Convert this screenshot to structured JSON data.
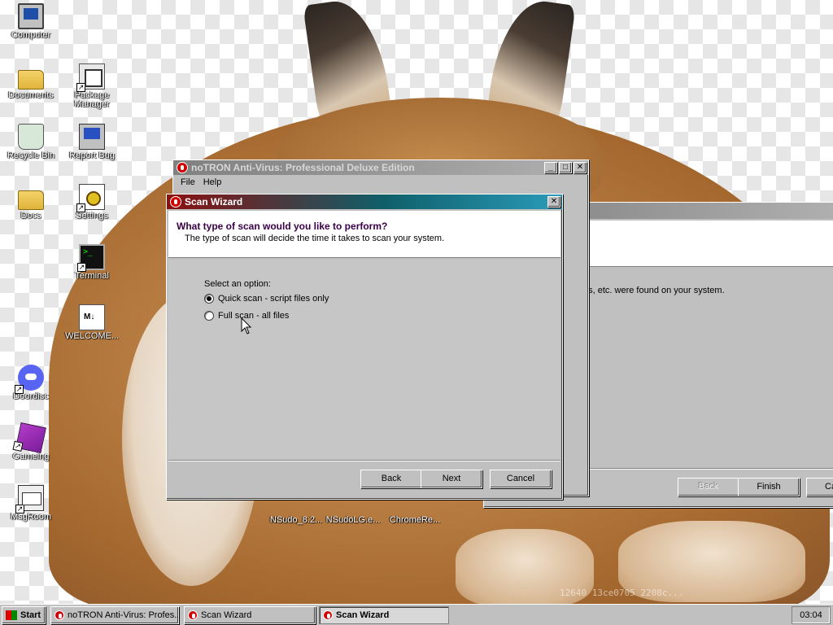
{
  "desktop": {
    "icons": [
      {
        "label": "Computer",
        "icon": "computer-icon"
      },
      {
        "label": "Documents",
        "icon": "folder-icon"
      },
      {
        "label": "Package Manager",
        "icon": "package-icon"
      },
      {
        "label": "Recycle Bin",
        "icon": "recycle-bin-icon"
      },
      {
        "label": "Report Bug",
        "icon": "report-bug-icon"
      },
      {
        "label": "Docs",
        "icon": "folder-icon"
      },
      {
        "label": "Settings",
        "icon": "settings-icon"
      },
      {
        "label": "Terminal",
        "icon": "terminal-icon"
      },
      {
        "label": "WELCOME...",
        "icon": "markdown-file-icon"
      },
      {
        "label": "Doordisc",
        "icon": "discord-icon"
      },
      {
        "label": "Gameing",
        "icon": "game-cube-icon"
      },
      {
        "label": "MsgRoom",
        "icon": "message-icon"
      },
      {
        "label": "NSudo_8.2...",
        "icon": "file-icon"
      },
      {
        "label": "NSudoLG.e...",
        "icon": "file-icon"
      },
      {
        "label": "ChromeRe...",
        "icon": "file-icon"
      }
    ],
    "wallpaper_text": "12640 13ce0705 2208c..."
  },
  "main_window": {
    "title": "noTRON Anti-Virus: Professional Deluxe Edition",
    "menu": [
      "File",
      "Help"
    ]
  },
  "back_window": {
    "body_text": "es, etc. were found on your system.",
    "buttons": {
      "back": "Back",
      "finish": "Finish",
      "cancel": "Ca"
    }
  },
  "wizard": {
    "title": "Scan Wizard",
    "heading": "What type of scan would you like to perform?",
    "subheading": "The type of scan will decide the time it takes to scan your system.",
    "prompt": "Select an option:",
    "options": [
      {
        "label": "Quick scan - script files only",
        "selected": true
      },
      {
        "label": "Full scan - all files",
        "selected": false
      }
    ],
    "buttons": {
      "back": "Back",
      "next": "Next",
      "cancel": "Cancel"
    }
  },
  "taskbar": {
    "start": "Start",
    "tasks": [
      {
        "label": "noTRON Anti-Virus: Profes...",
        "active": false
      },
      {
        "label": "Scan Wizard",
        "active": false
      },
      {
        "label": "Scan Wizard",
        "active": true
      }
    ],
    "clock": "03:04"
  },
  "colors": {
    "title_active_start": "#8b0f0f",
    "title_active_end": "#2a9bb8",
    "face": "#c0c0c0",
    "heading_text": "#3a0048"
  }
}
